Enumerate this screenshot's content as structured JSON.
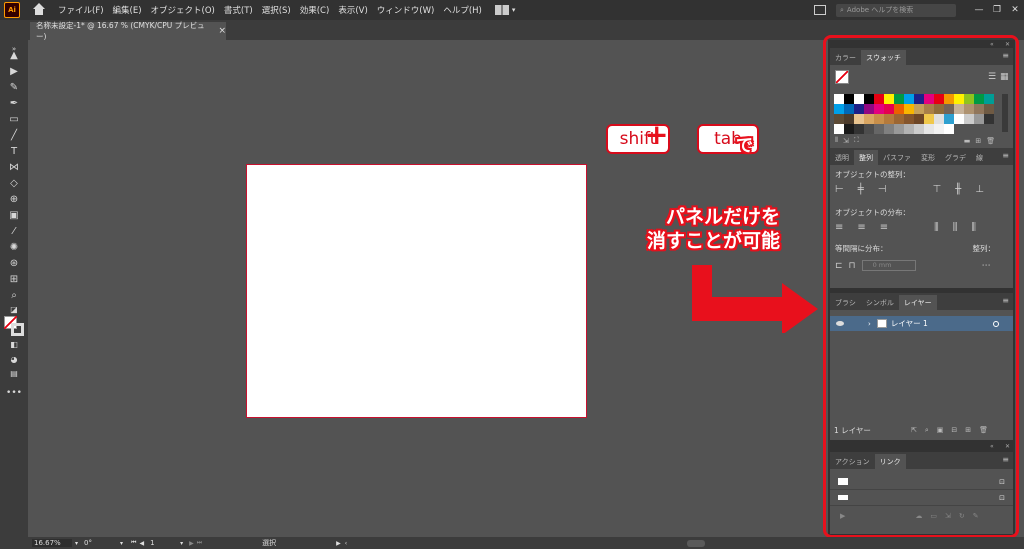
{
  "menubar": {
    "logo": "Ai",
    "items": [
      "ファイル(F)",
      "編集(E)",
      "オブジェクト(O)",
      "書式(T)",
      "選択(S)",
      "効果(C)",
      "表示(V)",
      "ウィンドウ(W)",
      "ヘルプ(H)"
    ],
    "search_placeholder": "Adobe ヘルプを検索"
  },
  "document": {
    "tab_title": "名称未設定-1* @ 16.67 % (CMYK/CPU プレビュー)",
    "close": "×"
  },
  "annotation": {
    "key1": "shift",
    "plus": "+",
    "key2": "tab",
    "suffix": "で",
    "line1": "パネルだけを",
    "line2": "消すことが可能",
    "color": "#e8101c"
  },
  "panels": {
    "color_tabs": [
      "カラー",
      "スウォッチ"
    ],
    "align_tabs": [
      "透明",
      "整列",
      "パスファ",
      "変形",
      "グラデ",
      "線"
    ],
    "align_objects": "オブジェクトの整列：",
    "distribute_objects": "オブジェクトの分布：",
    "distribute_spacing": "等間隔に分布：",
    "align_to": "整列：",
    "spacing_value": "0 mm",
    "layer_tabs": [
      "ブラシ",
      "シンボル",
      "レイヤー"
    ],
    "layer_name": "レイヤー 1",
    "layer_count": "1 レイヤー",
    "link_tabs": [
      "アクション",
      "リンク"
    ]
  },
  "statusbar": {
    "zoom": "16.67%",
    "rotate": "0°",
    "artboard": "1",
    "tool": "選択"
  },
  "swatch_colors": [
    "#ffffff",
    "#000000",
    "#ffffff",
    "#000000",
    "#e60012",
    "#fff100",
    "#009944",
    "#00a0e9",
    "#1d2088",
    "#e4007f",
    "#e60012",
    "#f39800",
    "#fff100",
    "#8fc31f",
    "#009944",
    "#009e96",
    "#00a0e9",
    "#0068b7",
    "#1d2088",
    "#920783",
    "#e4007f",
    "#e5004f",
    "#eb6100",
    "#f8b500",
    "#c5a05a",
    "#a98049",
    "#8f6d3b",
    "#736357",
    "#c7b299",
    "#ae9270",
    "#91765b",
    "#6f5a43",
    "#5d4b36",
    "#4c3b2b",
    "#e8c38f",
    "#d9a662",
    "#c88f4a",
    "#b47a3c",
    "#9c6632",
    "#85552c",
    "#6e4626",
    "#f0c84b",
    "#e0e0e0",
    "#2ea0d0",
    "#ffffff",
    "#cccccc",
    "#999999",
    "#333333",
    "#ffffff",
    "#1a1a1a",
    "#333333",
    "#4d4d4d",
    "#666666",
    "#808080",
    "#999999",
    "#b3b3b3",
    "#cccccc",
    "#e6e6e6",
    "#f2f2f2",
    "#ffffff"
  ]
}
